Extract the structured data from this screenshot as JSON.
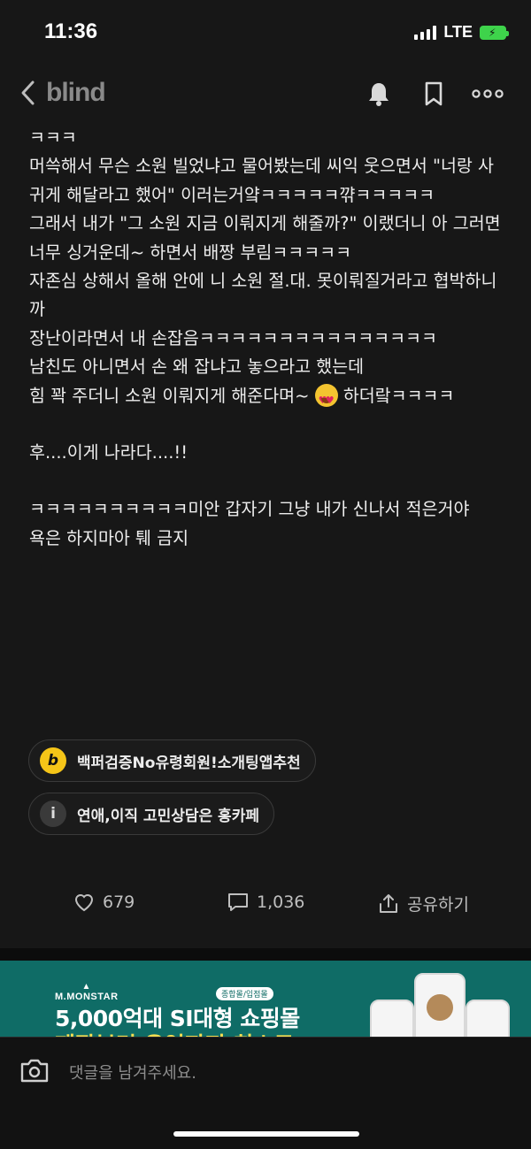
{
  "status": {
    "time": "11:36",
    "network": "LTE"
  },
  "header": {
    "logo": "blind"
  },
  "post": {
    "lines": [
      "ㅋㅋㅋ",
      "머쓱해서 무슨 소원 빌었냐고 물어봤는데 씨익 웃으면서 \"너랑 사귀게 해달라고 했어\" 이러는거얔ㅋㅋㅋㅋㅋ꺆ㅋㅋㅋㅋㅋ",
      "그래서 내가 \"그 소원 지금 이뤄지게 해줄까?\" 이랬더니 아 그러면 너무 싱거운데~ 하면서 배짱 부림ㅋㅋㅋㅋㅋ",
      "자존심 상해서 올해 안에 니 소원 절.대. 못이뤄질거라고 협박하니까",
      "장난이라면서 내 손잡음ㅋㅋㅋㅋㅋㅋㅋㅋㅋㅋㅋㅋㅋㅋㅋ",
      "남친도 아니면서 손 왜 잡냐고 놓으라고 했는데",
      "힘 꽉 주더니 소원 이뤄지게 해준다며~",
      "하더랔ㅋㅋㅋㅋ",
      "후....이게 나라다....!!",
      "ㅋㅋㅋㅋㅋㅋㅋㅋㅋㅋ미안 갑자기 그냥 내가 신나서 적은거야",
      "욕은 하지마아 퉤 금지"
    ]
  },
  "tags": [
    {
      "label": "백퍼검증No유령회원!소개팅앱추천",
      "icon_text": "b",
      "icon": "b-badge-icon"
    },
    {
      "label": "연애,이직 고민상담은 홍카페",
      "icon_text": "i",
      "icon": "info-icon"
    }
  ],
  "actions": {
    "likes": "679",
    "comments": "1,036",
    "share": "공유하기"
  },
  "ad": {
    "brand": "M.MONSTAR",
    "pill": "종합몰/입점몰",
    "headline": "5,000억대 SI대형 쇼핑몰",
    "subline": "제작부터 운영까지 최소로"
  },
  "comment": {
    "placeholder": "댓글을 남겨주세요."
  },
  "colors": {
    "background": "#171717",
    "ad_bg": "#0f6c66",
    "tag_yellow": "#f5c518"
  }
}
